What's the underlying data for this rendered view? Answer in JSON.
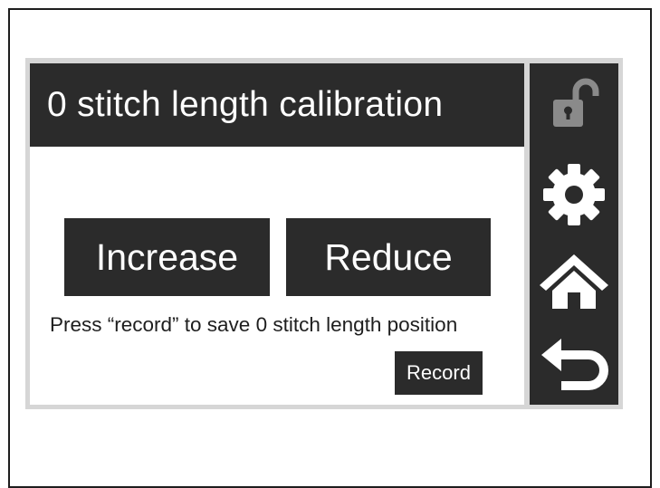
{
  "screen": {
    "title": "0 stitch length calibration",
    "buttons": {
      "increase_label": "Increase",
      "reduce_label": "Reduce",
      "record_label": "Record"
    },
    "instruction_text": "Press “record” to save 0 stitch length position"
  },
  "sidebar": {
    "icons": [
      "unlocked-padlock-icon",
      "gear-icon",
      "home-icon",
      "back-arrow-icon"
    ]
  },
  "colors": {
    "panel_dark": "#2b2b2b",
    "icon_gray": "#8a8a8a",
    "icon_white": "#ffffff",
    "background": "#ffffff",
    "bezel": "#d6d6d6"
  }
}
